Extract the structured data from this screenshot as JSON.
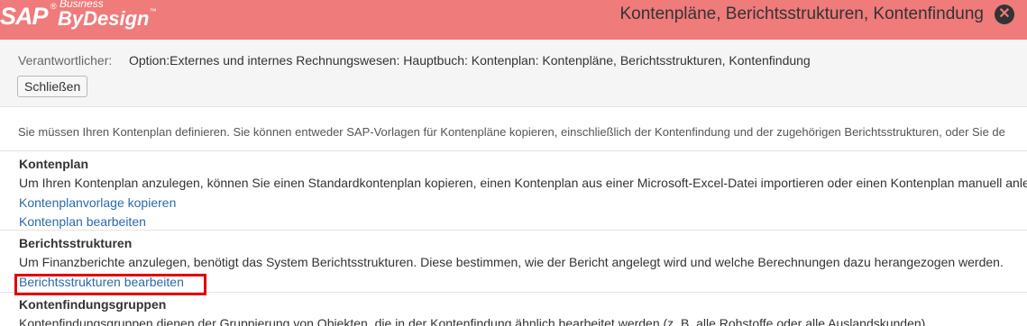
{
  "header": {
    "logo_sap": "SAP",
    "logo_registered": "®",
    "logo_business": "Business",
    "logo_bydesign": "ByDesign",
    "logo_tm": "™",
    "title": "Kontenpläne, Berichtsstrukturen, Kontenfindung",
    "close_icon": "close-icon"
  },
  "option_bar": {
    "responsible_label": "Verantwortlicher:",
    "option_text": "Option:Externes und internes Rechnungswesen: Hauptbuch: Kontenplan: Kontenpläne, Berichtsstrukturen, Kontenfindung",
    "close_button": "Schließen"
  },
  "intro": "Sie müssen Ihren Kontenplan definieren. Sie können entweder SAP-Vorlagen für Kontenpläne kopieren, einschließlich der Kontenfindung und der zugehörigen Berichtsstrukturen, oder Sie de",
  "sections": [
    {
      "heading": "Kontenplan",
      "description": "Um Ihren Kontenplan anzulegen, können Sie einen Standardkontenplan kopieren, einen Kontenplan aus einer Microsoft-Excel-Datei importieren oder einen Kontenplan manuell anle",
      "links": [
        "Kontenplanvorlage kopieren",
        "Kontenplan bearbeiten"
      ]
    },
    {
      "heading": "Berichtsstrukturen",
      "description": "Um Finanzberichte anzulegen, benötigt das System Berichtsstrukturen. Diese bestimmen, wie der Bericht angelegt wird und welche Berechnungen dazu herangezogen werden.",
      "links": [
        "Berichtsstrukturen bearbeiten"
      ]
    },
    {
      "heading": "Kontenfindungsgruppen",
      "description": "Kontenfindungsgruppen dienen der Gruppierung von Objekten, die in der Kontenfindung ähnlich bearbeitet werden (z. B. alle Rohstoffe oder alle Auslandskunden)."
    }
  ],
  "colors": {
    "header_bg": "#ef7b7b",
    "link": "#2c6aa8",
    "highlight": "#e00000"
  }
}
